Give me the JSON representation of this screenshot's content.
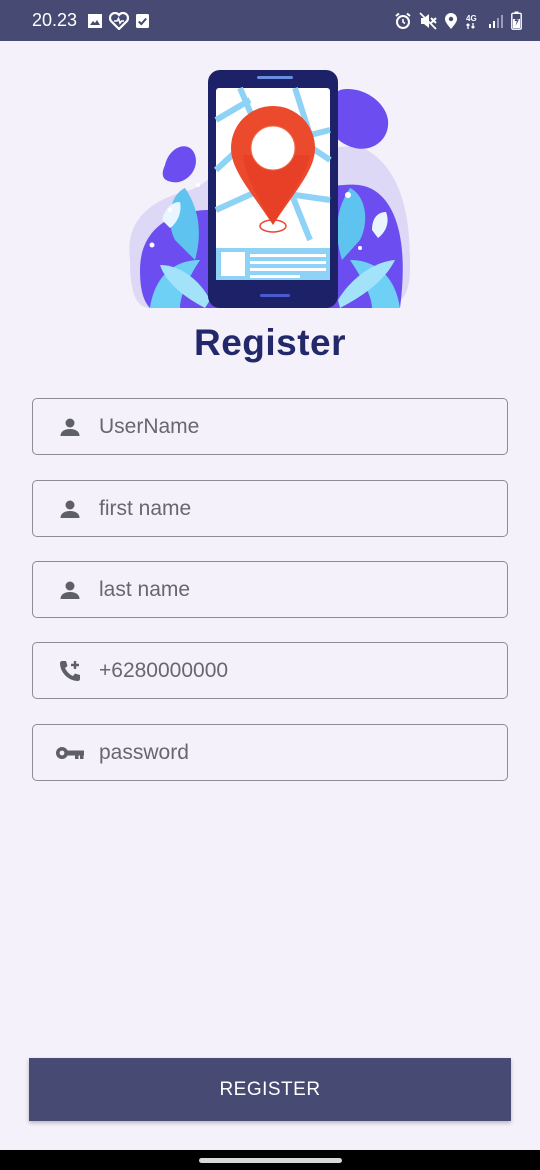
{
  "status_bar": {
    "time": "20.23",
    "left_icons": [
      "gallery-icon",
      "heart-pulse-icon",
      "checkbox-icon"
    ],
    "right_icons": [
      "alarm-icon",
      "mute-icon",
      "location-icon",
      "4g-icon",
      "signal-icon",
      "battery-icon"
    ],
    "network_label": "4G"
  },
  "header": {
    "title": "Register"
  },
  "form": {
    "username": {
      "placeholder": "UserName",
      "icon": "person-icon"
    },
    "first_name": {
      "placeholder": "first name",
      "icon": "person-icon"
    },
    "last_name": {
      "placeholder": "last name",
      "icon": "person-icon"
    },
    "phone": {
      "placeholder": "+6280000000",
      "icon": "phone-add-icon"
    },
    "password": {
      "placeholder": "password",
      "icon": "key-icon"
    }
  },
  "actions": {
    "register_label": "REGISTER"
  },
  "colors": {
    "primary": "#474a72",
    "title": "#23286b",
    "background": "#f4f1fb",
    "pin": "#e9472e"
  }
}
